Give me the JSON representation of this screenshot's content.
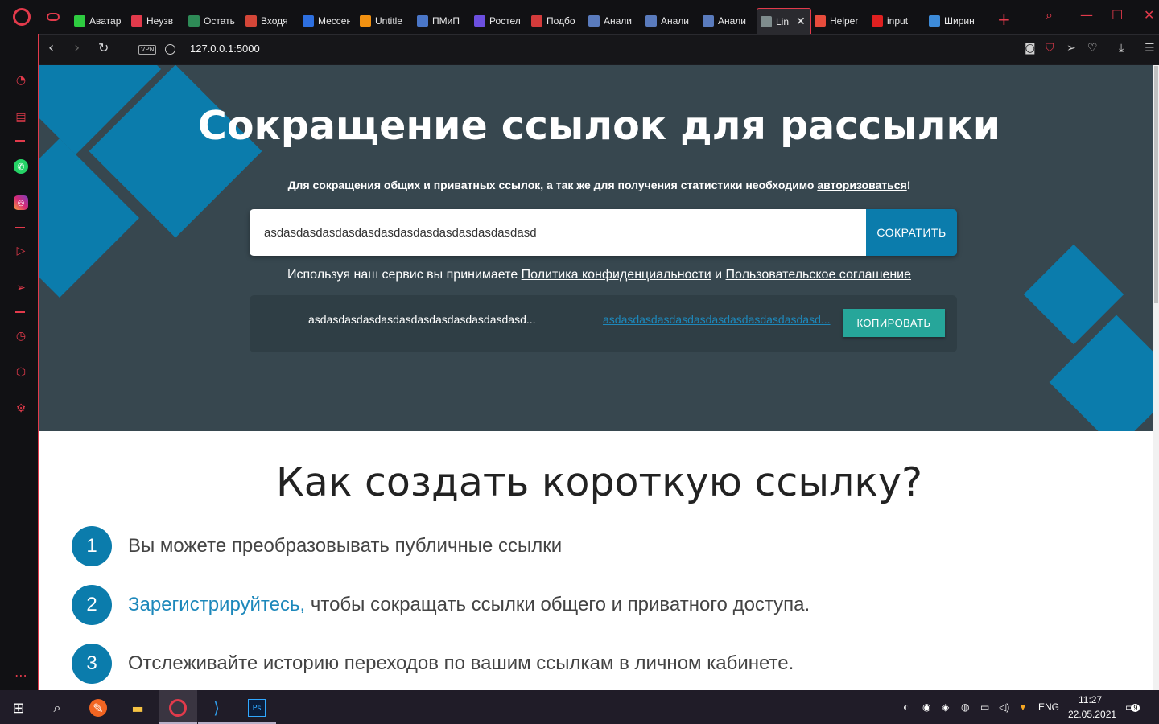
{
  "browser": {
    "tabs": [
      {
        "label": "Аватар",
        "color": "#2ecc40"
      },
      {
        "label": "Неузв",
        "color": "#e23a4b"
      },
      {
        "label": "Остать",
        "color": "#2e8b57"
      },
      {
        "label": "Входя",
        "color": "#d44638"
      },
      {
        "label": "Мессен",
        "color": "#2d6fe0"
      },
      {
        "label": "Untitle",
        "color": "#f29111"
      },
      {
        "label": "ПМиП",
        "color": "#4a76c8"
      },
      {
        "label": "Ростел",
        "color": "#6c4fe0"
      },
      {
        "label": "Подбо",
        "color": "#d33b3b"
      },
      {
        "label": "Анали",
        "color": "#5a7bbd"
      },
      {
        "label": "Анали",
        "color": "#5a7bbd"
      },
      {
        "label": "Анали",
        "color": "#5a7bbd"
      },
      {
        "label": "Lin",
        "color": "#7f8c8d",
        "active": true
      },
      {
        "label": "Helper",
        "color": "#e74c3c"
      },
      {
        "label": "input",
        "color": "#e02020"
      },
      {
        "label": "Ширин",
        "color": "#3d8bd9"
      }
    ],
    "new_tab": "+",
    "url": "127.0.0.1:5000",
    "vpn_label": "VPN"
  },
  "page": {
    "hero_title": "Сокращение ссылок для рассылки",
    "hero_sub_prefix": "Для сокращения общих и приватных ссылок, а так же для получения статистики необходимо ",
    "hero_sub_link": "авторизоваться",
    "hero_sub_suffix": "!",
    "input_value": "asdasdasdasdasdasdasdasdasdasdasdasdasdasd",
    "shorten_label": "СОКРАТИТЬ",
    "terms_prefix": "Используя наш сервис вы принимаете ",
    "terms_privacy": "Политика конфиденциальности",
    "terms_and": " и ",
    "terms_agreement": "Пользовательское соглашение",
    "result_long": "asdasdasdasdasdasdasdasdasdasdasdasd...",
    "result_short": "asdasdasdasdasdasdasdasdasdasdasdasd...",
    "copy_label": "КОПИРОВАТЬ",
    "how_title": "Как создать короткую ссылку?",
    "steps": [
      {
        "num": "1",
        "text": "Вы можете преобразовывать публичные ссылки"
      },
      {
        "num": "2",
        "link": "Зарегистрируйтесь,",
        "text": " чтобы сокращать ссылки общего и приватного доступа."
      },
      {
        "num": "3",
        "text": "Отслеживайте историю переходов по вашим ссылкам в личном кабинете."
      }
    ],
    "colors": {
      "hero_bg": "#37474f",
      "accent": "#0b7cac",
      "copy_btn": "#26a69a"
    }
  },
  "taskbar": {
    "lang": "ENG",
    "time": "11:27",
    "date": "22.05.2021",
    "notifications": "9"
  }
}
